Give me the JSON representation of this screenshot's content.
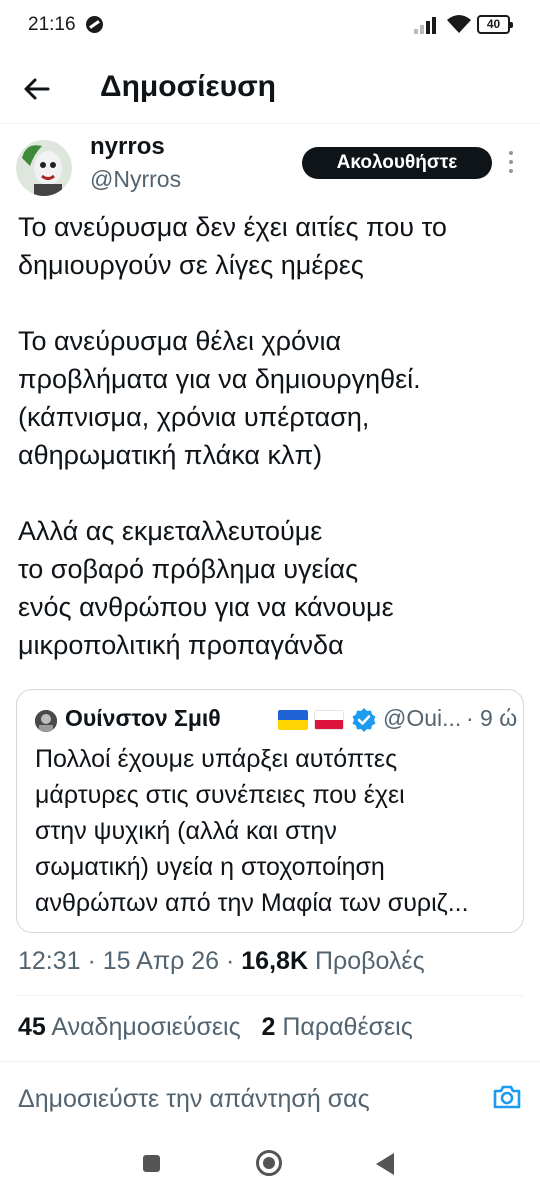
{
  "status_bar": {
    "time": "21:16",
    "battery": "40"
  },
  "header": {
    "title": "Δημοσίευση"
  },
  "author": {
    "name": "nyrros",
    "handle": "@Nyrros"
  },
  "follow_label": "Ακολουθήστε",
  "tweet": {
    "lines": [
      "Το ανεύρυσμα δεν έχει αιτίες που το",
      "δημιουργούν σε λίγες ημέρες",
      "",
      "Το ανεύρυσμα θέλει χρόνια",
      "προβλήματα για να δημιουργηθεί.",
      "(κάπνισμα, χρόνια υπέρταση,",
      "αθηρωματική πλάκα κλπ)",
      "",
      "Αλλά ας εκμεταλλευτούμε",
      "το σοβαρό πρόβλημα υγείας",
      "ενός ανθρώπου για να κάνουμε",
      "μικροπολιτική προπαγάνδα"
    ]
  },
  "quote": {
    "name": "Ουίνστον Σμιθ",
    "handle": "@Oui...",
    "time": "· 9 ώ",
    "lines": [
      "Πολλοί έχουμε υπάρξει αυτόπτες",
      "μάρτυρες στις συνέπειες που έχει",
      "στην ψυχική (αλλά και στην",
      "σωματική) υγεία η στοχοποίηση",
      "ανθρώπων από την Μαφία των συριζ..."
    ]
  },
  "meta": {
    "time_date": "12:31 · 15 Απρ 26 · ",
    "views_count": "16,8K",
    "views_label": " Προβολές"
  },
  "stats": {
    "reposts_count": "45",
    "reposts_label": " Αναδημοσιεύσεις",
    "quotes_count": "2",
    "quotes_label": " Παραθέσεις"
  },
  "reply": {
    "placeholder": "Δημοσιεύστε την απάντησή σας"
  },
  "colors": {
    "accent": "#1d9bf0",
    "text": "#0f1419",
    "muted": "#536471",
    "border": "#cfd9de"
  }
}
